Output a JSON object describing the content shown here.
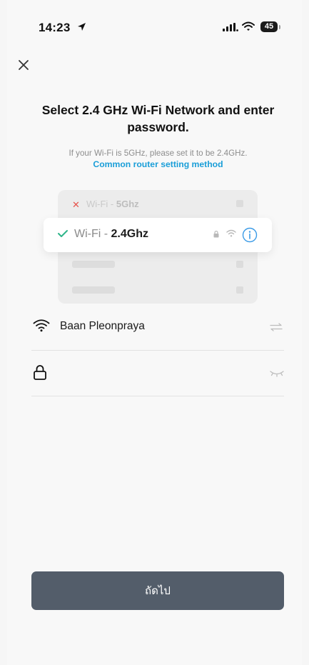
{
  "status_bar": {
    "time": "14:23",
    "battery": "45"
  },
  "page": {
    "title": "Select 2.4 GHz Wi-Fi Network and enter password.",
    "hint": "If your Wi-Fi is 5GHz, please set it to be 2.4GHz.",
    "router_link": "Common router setting method"
  },
  "illustration": {
    "wifi_5g_prefix": "Wi-Fi - ",
    "wifi_5g_band": "5Ghz",
    "wifi_24_prefix": "Wi-Fi - ",
    "wifi_24_band": "2.4Ghz"
  },
  "form": {
    "ssid": "Baan Pleonpraya",
    "password": "",
    "password_placeholder": ""
  },
  "next_button_label": "ถัดไป",
  "colors": {
    "accent_link": "#1a9ed8",
    "check_green": "#2fb58a",
    "x_red": "#e6534b",
    "button_bg": "#535d6a"
  }
}
